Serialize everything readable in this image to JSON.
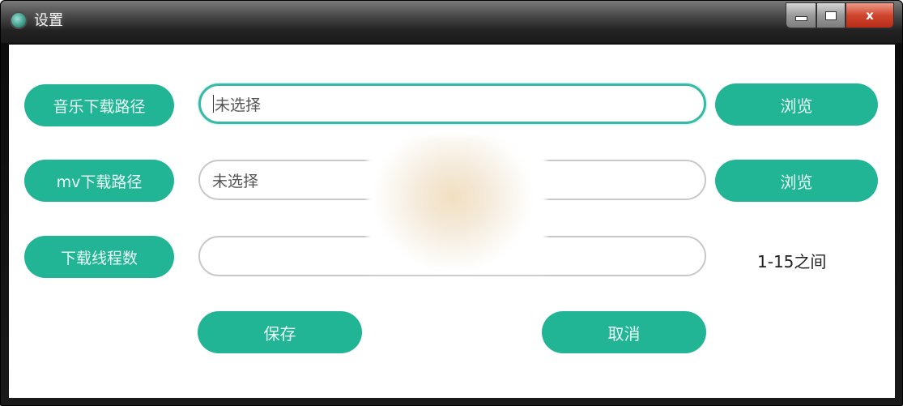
{
  "window": {
    "title": "设置",
    "controls": {
      "minimize": "minimize",
      "maximize": "maximize",
      "close": "x"
    }
  },
  "form": {
    "music_path": {
      "label": "音乐下载路径",
      "value": "未选择",
      "browse": "浏览",
      "focused": true
    },
    "mv_path": {
      "label": "mv下载路径",
      "value": "未选择",
      "browse": "浏览"
    },
    "threads": {
      "label": "下载线程数",
      "value": "",
      "hint": "1-15之间"
    }
  },
  "actions": {
    "save": "保存",
    "cancel": "取消"
  },
  "colors": {
    "accent": "#21b595",
    "focus_border": "#38b9a5",
    "close_red": "#d0452d"
  }
}
